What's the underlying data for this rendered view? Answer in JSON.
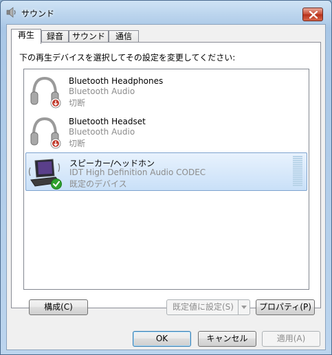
{
  "window": {
    "title": "サウンド",
    "icons": {
      "title": "speaker-icon",
      "close": "close-icon"
    }
  },
  "tabs": [
    {
      "label": "再生",
      "active": true
    },
    {
      "label": "録音",
      "active": false
    },
    {
      "label": "サウンド",
      "active": false
    },
    {
      "label": "通信",
      "active": false
    }
  ],
  "panel": {
    "instruction": "下の再生デバイスを選択してその設定を変更してください:"
  },
  "devices": [
    {
      "name": "Bluetooth Headphones",
      "description": "Bluetooth Audio",
      "status": "切断",
      "icon": "headphones-icon",
      "badge": "disconnected-badge-icon",
      "selected": false
    },
    {
      "name": "Bluetooth Headset",
      "description": "Bluetooth Audio",
      "status": "切断",
      "icon": "headphones-icon",
      "badge": "disconnected-badge-icon",
      "selected": false
    },
    {
      "name": "スピーカー/ヘッドホン",
      "description": "IDT High Definition Audio CODEC",
      "status": "既定のデバイス",
      "icon": "laptop-speaker-icon",
      "badge": "default-check-icon",
      "selected": true
    }
  ],
  "buttons": {
    "configure": "構成(C)",
    "set_default": "既定値に設定(S)",
    "properties": "プロパティ(P)",
    "ok": "OK",
    "cancel": "キャンセル",
    "apply": "適用(A)"
  },
  "colors": {
    "selection_bg": "#c9e0f8",
    "selection_border": "#7da2ce",
    "secondary_text": "#8c8c8c",
    "disconnected_badge": "#c0392b",
    "default_check": "#2ea12e"
  }
}
